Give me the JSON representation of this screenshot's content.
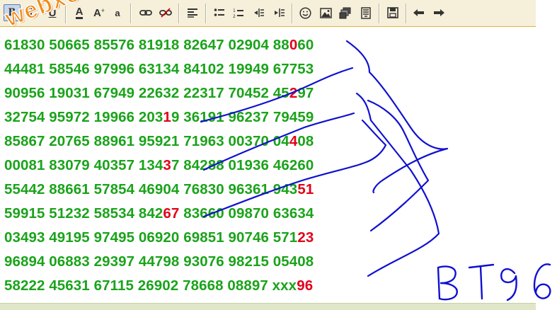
{
  "toolbar": {
    "buttons": [
      {
        "name": "bold-button",
        "icon": "bold-icon",
        "label": "B",
        "active": true
      },
      {
        "name": "italic-button",
        "icon": "italic-icon",
        "label": "I"
      },
      {
        "name": "underline-button",
        "icon": "underline-icon",
        "label": "U"
      },
      {
        "name": "font-color-button",
        "icon": "font-color-icon",
        "label": "A"
      },
      {
        "name": "font-size-button",
        "icon": "font-size-icon",
        "label": "A"
      },
      {
        "name": "text-style-button",
        "icon": "text-style-icon",
        "label": "a"
      },
      {
        "name": "link-button",
        "icon": "link-icon"
      },
      {
        "name": "unlink-button",
        "icon": "unlink-icon"
      },
      {
        "name": "align-left-button",
        "icon": "align-left-icon"
      },
      {
        "name": "bullet-list-button",
        "icon": "bullet-list-icon"
      },
      {
        "name": "numbered-list-button",
        "icon": "numbered-list-icon"
      },
      {
        "name": "outdent-button",
        "icon": "outdent-icon"
      },
      {
        "name": "indent-button",
        "icon": "indent-icon"
      },
      {
        "name": "emoji-button",
        "icon": "smiley-icon"
      },
      {
        "name": "insert-image-button",
        "icon": "image-icon"
      },
      {
        "name": "insert-media-button",
        "icon": "media-icon"
      },
      {
        "name": "insert-document-button",
        "icon": "document-icon"
      },
      {
        "name": "save-button",
        "icon": "save-icon"
      },
      {
        "name": "undo-button",
        "icon": "undo-icon"
      },
      {
        "name": "redo-button",
        "icon": "redo-icon"
      }
    ]
  },
  "colors": {
    "number_text": "#1aa31a",
    "highlight": "#e2001a",
    "annotation": "#1010d0",
    "watermark": "#f08a16",
    "toolbar_bg": "#f6efd9"
  },
  "watermark": {
    "text": "webxoso.net"
  },
  "lines": [
    {
      "pre": "61830 50665 85576 81918 82647 02904 88",
      "hl": "0",
      "post": "60"
    },
    {
      "pre": "44481 58546 97996 63134 84102 19949 67753",
      "hl": "",
      "post": ""
    },
    {
      "pre": "90956 19031 67949 22632 22317 70452 45",
      "hl": "2",
      "post": "97"
    },
    {
      "pre": "32754 95972 19966 203",
      "hl": "1",
      "post": "9 36191 96237 79459"
    },
    {
      "pre": "85867 20765 88961 95921 71963 00370 04",
      "hl": "4",
      "post": "08"
    },
    {
      "pre": "00081 83079 40357 134",
      "hl": "3",
      "post": "7 84288 01936 46260"
    },
    {
      "pre": "55442 88661 57854 46904 76830 96361 943",
      "hl": "51",
      "post": ""
    },
    {
      "pre": "59915 51232 58534 842",
      "hl": "67",
      "post": " 83660 09870 63634"
    },
    {
      "pre": "03493 49195 97495 06920 69851 90746 571",
      "hl": "23",
      "post": ""
    },
    {
      "pre": "96894 06883 29397 44798 93076 98215 05408",
      "hl": "",
      "post": ""
    },
    {
      "pre": "58222 45631 67115 26902 78668 08897 xxx",
      "hl": "96",
      "post": ""
    }
  ],
  "annotation": {
    "text": "BT96"
  }
}
